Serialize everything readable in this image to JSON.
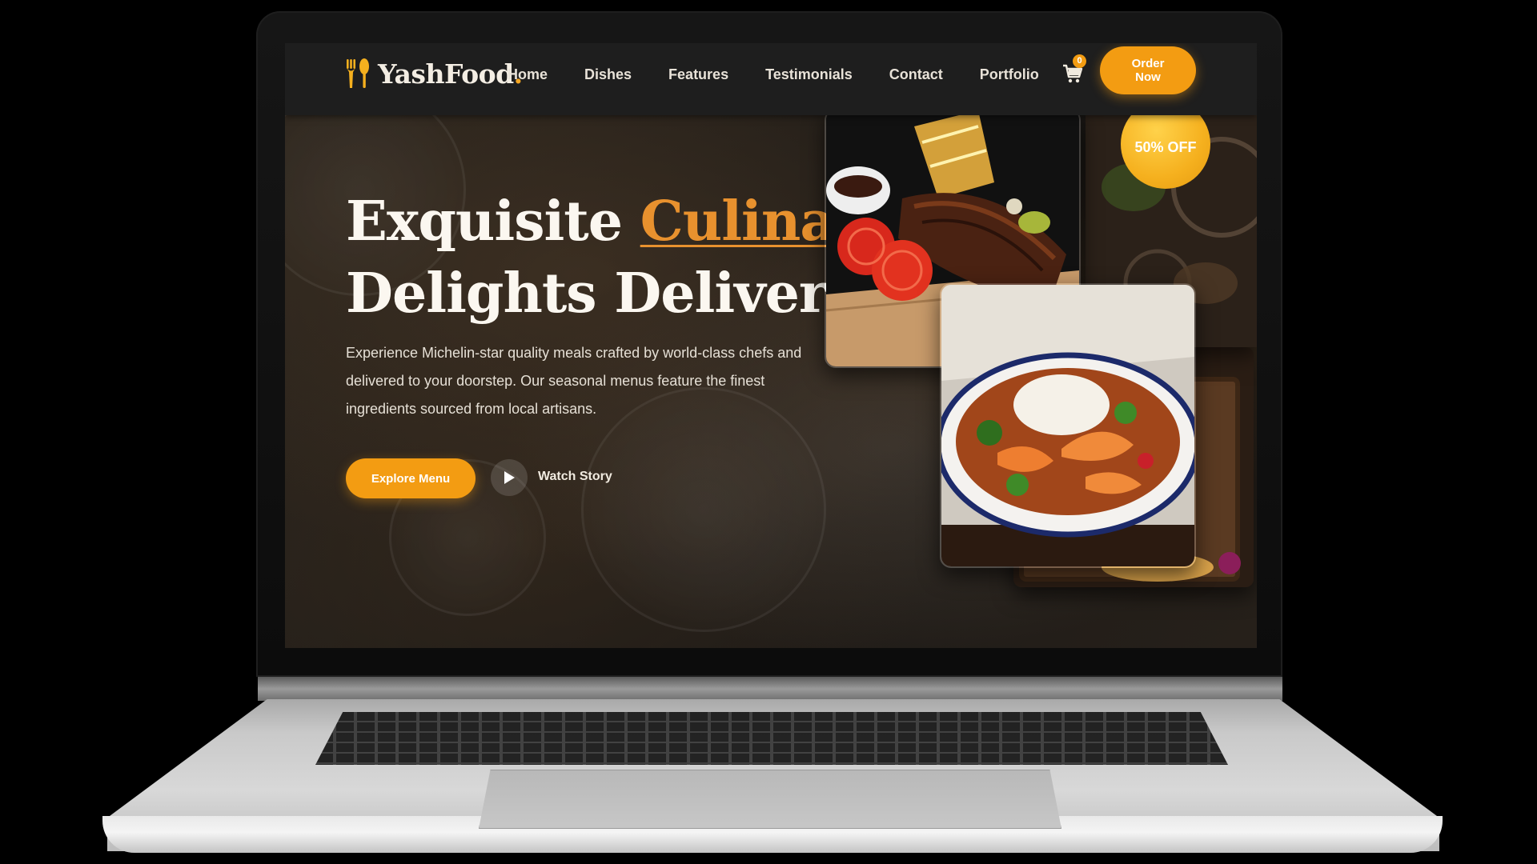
{
  "brand": {
    "name": "YashFood",
    "dot": "."
  },
  "nav": {
    "links": [
      "Home",
      "Dishes",
      "Features",
      "Testimonials",
      "Contact",
      "Portfolio"
    ],
    "cart_count": "0",
    "order_button": "Order Now"
  },
  "hero": {
    "title_part1": "Exquisite ",
    "title_accent": "Culinary",
    "title_line2": "Delights Delivered",
    "description": "Experience Michelin-star quality meals crafted by world-class chefs and delivered to your doorstep. Our seasonal menus feature the finest ingredients sourced from local artisans.",
    "primary_button": "Explore Menu",
    "secondary_button": "Watch Story"
  },
  "promo_badge": "50% OFF",
  "icons": {
    "logo": "fork-spoon-icon",
    "cart": "shopping-cart-icon",
    "play": "play-icon"
  },
  "colors": {
    "accent": "#f39c12",
    "title_accent": "#e8912e",
    "navbar": "#1e1e1e",
    "text_light": "#fbf7f0"
  }
}
